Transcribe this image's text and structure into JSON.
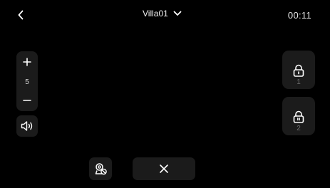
{
  "header": {
    "title": "Villa01",
    "timer": "00:11",
    "back_icon": "chevron-left-icon",
    "dropdown_icon": "chevron-down-icon"
  },
  "zoom": {
    "value": "5",
    "plus_icon": "plus-icon",
    "minus_icon": "minus-icon"
  },
  "speaker": {
    "icon": "speaker-icon"
  },
  "locks": [
    {
      "number": "1",
      "icon": "lock-icon"
    },
    {
      "number": "2",
      "icon": "lock-icon"
    }
  ],
  "bottom_bar": {
    "camera_icon": "camera-off-icon",
    "hangup_icon": "close-icon"
  },
  "colors": {
    "background": "#000000",
    "button_bg": "#1b1b1b",
    "text": "#ffffff",
    "muted_text": "#6e6e6e"
  }
}
